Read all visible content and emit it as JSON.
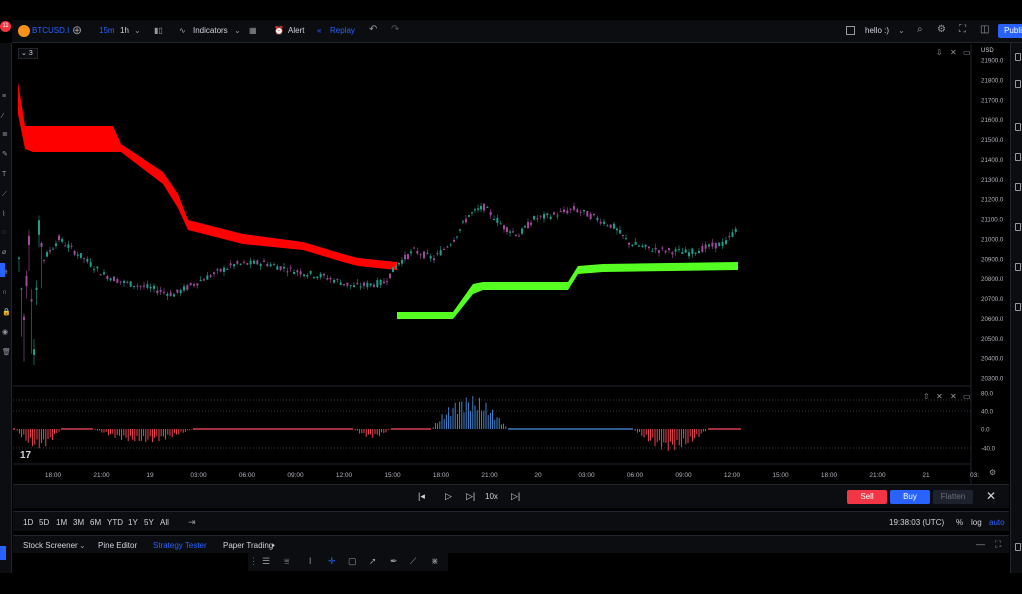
{
  "header": {
    "notifications": "11",
    "symbol": "BTCUSD.I",
    "interval_minutes": "15m",
    "interval_hour": "1h",
    "indicators_label": "Indicators",
    "alert_label": "Alert",
    "replay_label": "Replay",
    "layout_name": "hello :)",
    "publish_label": "Publi"
  },
  "chart": {
    "legend_toggle": "3",
    "currency": "USD",
    "price_ticks": [
      "21900.0",
      "21800.0",
      "21700.0",
      "21600.0",
      "21500.0",
      "21400.0",
      "21300.0",
      "21200.0",
      "21100.0",
      "21000.0",
      "20900.0",
      "20800.0",
      "20700.0",
      "20600.0",
      "20500.0",
      "20400.0",
      "20300.0"
    ],
    "osc_ticks": [
      "80.0",
      "40.0",
      "0.0",
      "-40.0"
    ],
    "time_ticks": [
      "18:00",
      "21:00",
      "19",
      "03:00",
      "06:00",
      "09:00",
      "12:00",
      "15:00",
      "18:00",
      "21:00",
      "20",
      "03:00",
      "06:00",
      "09:00",
      "12:00",
      "15:00",
      "18:00",
      "21:00",
      "21",
      "03:"
    ]
  },
  "replay": {
    "speed": "10x",
    "sell_label": "Sell",
    "buy_label": "Buy",
    "flatten_label": "Flatten"
  },
  "ranges": {
    "items": [
      "1D",
      "5D",
      "1M",
      "3M",
      "6M",
      "YTD",
      "1Y",
      "5Y",
      "All"
    ],
    "clock": "19:38:03 (UTC)",
    "percent": "%",
    "log": "log",
    "auto": "auto"
  },
  "bottom_tabs": {
    "stock_screener": "Stock Screener",
    "pine_editor": "Pine Editor",
    "strategy_tester": "Strategy Tester",
    "paper_trading": "Paper Trading"
  },
  "colors": {
    "accent": "#2962ff",
    "cloud_red": "#ff0000",
    "cloud_green": "#55ff22",
    "candle": "#a04a9a",
    "hist_red": "#ff4d5a",
    "hist_blue": "#4a90e2",
    "sell": "#f23645",
    "buy": "#2962ff"
  }
}
